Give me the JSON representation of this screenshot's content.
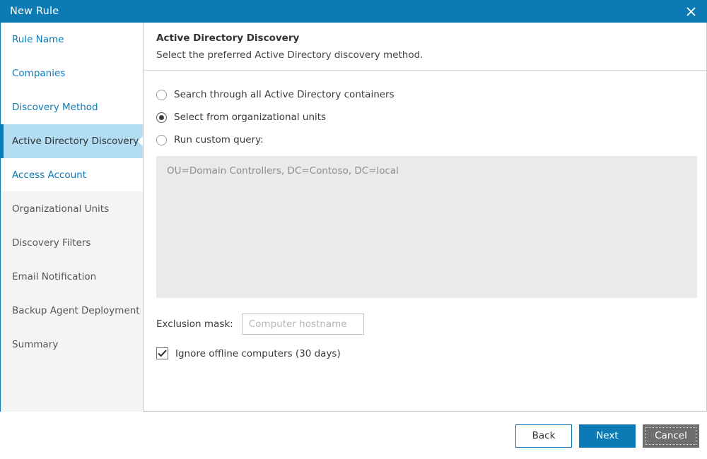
{
  "window": {
    "title": "New Rule",
    "close_icon": "close-icon",
    "accent_color": "#0b7ab5"
  },
  "sidebar": {
    "items": [
      {
        "label": "Rule Name",
        "state": "link"
      },
      {
        "label": "Companies",
        "state": "link"
      },
      {
        "label": "Discovery Method",
        "state": "link"
      },
      {
        "label": "Active Directory Discovery",
        "state": "active"
      },
      {
        "label": "Access Account",
        "state": "link"
      },
      {
        "label": "Organizational Units",
        "state": "muted"
      },
      {
        "label": "Discovery Filters",
        "state": "muted"
      },
      {
        "label": "Email Notification",
        "state": "muted"
      },
      {
        "label": "Backup Agent Deployment",
        "state": "muted"
      },
      {
        "label": "Summary",
        "state": "muted"
      }
    ],
    "active_background": "#b3ddf2",
    "muted_background": "#f4f4f4"
  },
  "header": {
    "title": "Active Directory Discovery",
    "subtitle": "Select the preferred Active Directory discovery method."
  },
  "discovery_options": [
    {
      "label": "Search through all Active Directory containers",
      "selected": false
    },
    {
      "label": "Select from organizational units",
      "selected": true
    },
    {
      "label": "Run custom query:",
      "selected": false
    }
  ],
  "query_box": {
    "value": "OU=Domain Controllers, DC=Contoso, DC=local",
    "enabled": false
  },
  "exclusion_mask": {
    "label": "Exclusion mask:",
    "value": "",
    "placeholder": "Computer hostname"
  },
  "ignore_offline": {
    "label": "Ignore offline computers (30 days)",
    "checked": true,
    "check_icon": "check-icon"
  },
  "footer": {
    "back_label": "Back",
    "next_label": "Next",
    "cancel_label": "Cancel"
  }
}
